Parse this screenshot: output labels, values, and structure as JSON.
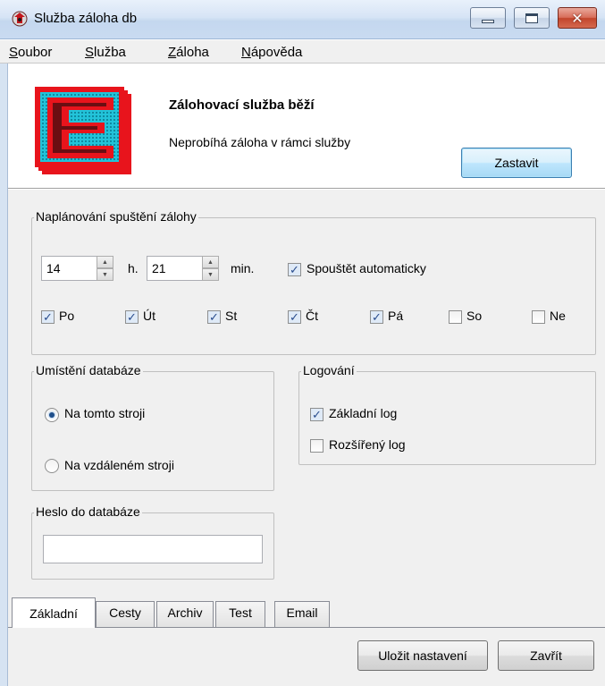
{
  "window": {
    "title": "Služba záloha db"
  },
  "menu": [
    {
      "label": "Soubor",
      "accel": "S",
      "rest": "oubor"
    },
    {
      "label": "Služba",
      "accel": "S",
      "rest": "lužba"
    },
    {
      "label": "Záloha",
      "accel": "Z",
      "rest": "áloha"
    },
    {
      "label": "Nápověda",
      "accel": "N",
      "rest": "ápověda"
    }
  ],
  "header": {
    "status_title": "Zálohovací služba běží",
    "status_sub": "Neprobíhá záloha v rámci služby",
    "stop_button": "Zastavit"
  },
  "schedule": {
    "legend": "Naplánování spuštění zálohy",
    "hour": "14",
    "hour_unit": "h.",
    "minute": "21",
    "minute_unit": "min.",
    "auto_label": "Spouštět automaticky",
    "auto_checked": true,
    "days": [
      {
        "label": "Po",
        "checked": true
      },
      {
        "label": "Út",
        "checked": true
      },
      {
        "label": "St",
        "checked": true
      },
      {
        "label": "Čt",
        "checked": true
      },
      {
        "label": "Pá",
        "checked": true
      },
      {
        "label": "So",
        "checked": false
      },
      {
        "label": "Ne",
        "checked": false
      }
    ]
  },
  "db_location": {
    "legend": "Umístění databáze",
    "options": [
      {
        "label": "Na tomto stroji",
        "selected": true
      },
      {
        "label": "Na vzdáleném stroji",
        "selected": false
      }
    ]
  },
  "logging": {
    "legend": "Logování",
    "options": [
      {
        "label": "Základní log",
        "checked": true
      },
      {
        "label": "Rozšířený log",
        "checked": false
      }
    ]
  },
  "password": {
    "legend": "Heslo do databáze",
    "value": ""
  },
  "tabs": [
    {
      "label": "Základní",
      "active": true
    },
    {
      "label": "Cesty",
      "active": false
    },
    {
      "label": "Archiv",
      "active": false
    },
    {
      "label": "Test",
      "active": false
    },
    {
      "label": "Email",
      "active": false
    }
  ],
  "footer": {
    "save_button": "Uložit nastavení",
    "close_button": "Zavřít"
  },
  "colors": {
    "logo_red": "#e8141c",
    "logo_cyan": "#22c3d9",
    "checkmark": "#2a4d8e"
  }
}
